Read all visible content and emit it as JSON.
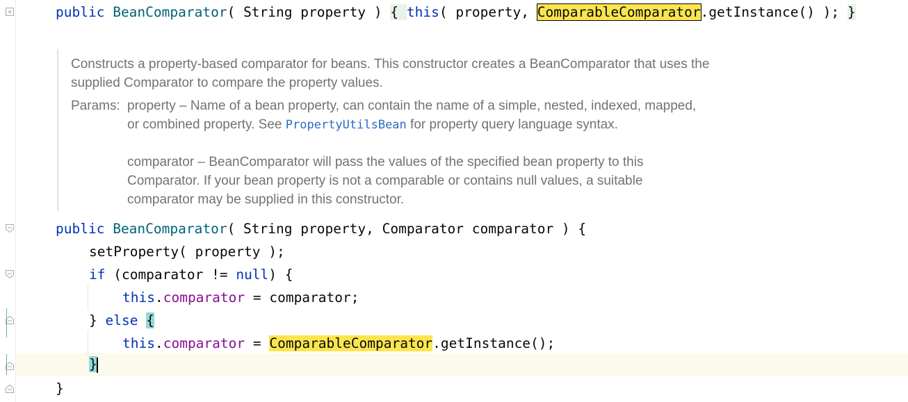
{
  "line1": {
    "kw_public": "public",
    "class_name": "BeanComparator",
    "open_paren": "( ",
    "type_string": "String",
    "param_property": " property ) ",
    "brace_open": "{",
    "kw_this": "this",
    "call_open": "( property, ",
    "highlight_class": "ComparableComparator",
    "call_rest": ".getInstance() ); ",
    "brace_close": "}"
  },
  "javadoc": {
    "description": "Constructs a property-based comparator for beans. This constructor creates a BeanComparator that uses the supplied Comparator to compare the property values.",
    "params_label": "Params:",
    "param1_text_a": "property – Name of a bean property, can contain the name of a simple, nested, indexed, mapped, or combined property. See ",
    "param1_link": "PropertyUtilsBean",
    "param1_text_b": " for property query language syntax.",
    "param2_text": "comparator – BeanComparator will pass the values of the specified bean property to this Comparator. If your bean property is not a comparable or contains null values, a suitable comparator may be supplied in this constructor."
  },
  "line2": {
    "kw_public": "public",
    "class_name": "BeanComparator",
    "rest": "( String property, Comparator comparator ) {"
  },
  "line3": {
    "text": "setProperty( property );"
  },
  "line4": {
    "kw_if": "if",
    "cond_a": " (comparator != ",
    "kw_null": "null",
    "cond_b": ") {"
  },
  "line5": {
    "kw_this": "this",
    "dot": ".",
    "field": "comparator",
    "rest": " = comparator;"
  },
  "line6": {
    "close": "} ",
    "kw_else": "else",
    "space": " ",
    "brace": "{"
  },
  "line7": {
    "kw_this": "this",
    "dot": ".",
    "field": "comparator",
    "eq": " = ",
    "highlight_class": "ComparableComparator",
    "rest": ".getInstance();"
  },
  "line8": {
    "brace": "}"
  },
  "line9": {
    "brace": "}"
  },
  "colors": {
    "keyword": "#0033b3",
    "class": "#00627a",
    "field": "#871094",
    "highlight": "#fbe54e",
    "brace_match": "#93d9d9",
    "doc_text": "#727272",
    "doc_link": "#2a6cc5"
  },
  "icons": [
    "fold-expand-icon",
    "fold-collapse-icon",
    "fold-end-icon"
  ]
}
